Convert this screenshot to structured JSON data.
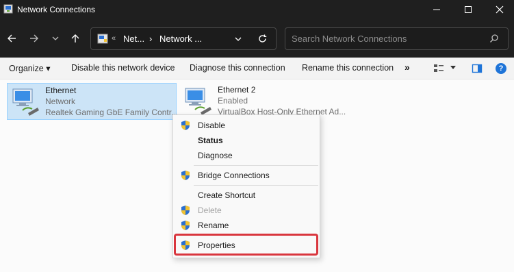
{
  "window": {
    "title": "Network Connections"
  },
  "address": {
    "crumbs": [
      "Net...",
      "Network ..."
    ],
    "prefix": "«",
    "separator": "›"
  },
  "search": {
    "placeholder": "Search Network Connections"
  },
  "toolbar": {
    "organize": "Organize ▾",
    "disable": "Disable this network device",
    "diagnose": "Diagnose this connection",
    "rename": "Rename this connection",
    "more": "»",
    "help": "?"
  },
  "connections": [
    {
      "name": "Ethernet",
      "status": "Network",
      "device": "Realtek Gaming GbE Family Contr...",
      "selected": true
    },
    {
      "name": "Ethernet 2",
      "status": "Enabled",
      "device": "VirtualBox Host-Only Ethernet Ad...",
      "selected": false
    }
  ],
  "context_menu": {
    "items": [
      {
        "label": "Disable",
        "shield": true,
        "bold": false,
        "disabled": false
      },
      {
        "label": "Status",
        "shield": false,
        "bold": true,
        "disabled": false
      },
      {
        "label": "Diagnose",
        "shield": false,
        "bold": false,
        "disabled": false
      },
      {
        "label": "Bridge Connections",
        "shield": true,
        "bold": false,
        "disabled": false
      },
      {
        "label": "Create Shortcut",
        "shield": false,
        "bold": false,
        "disabled": false
      },
      {
        "label": "Delete",
        "shield": true,
        "bold": false,
        "disabled": true
      },
      {
        "label": "Rename",
        "shield": true,
        "bold": false,
        "disabled": false
      },
      {
        "label": "Properties",
        "shield": true,
        "bold": false,
        "disabled": false,
        "highlighted": true
      }
    ]
  },
  "colors": {
    "titlebar": "#1f1f1f",
    "selection": "#cce4f7",
    "highlight": "#d9363e",
    "help_accent": "#1e74d8"
  }
}
